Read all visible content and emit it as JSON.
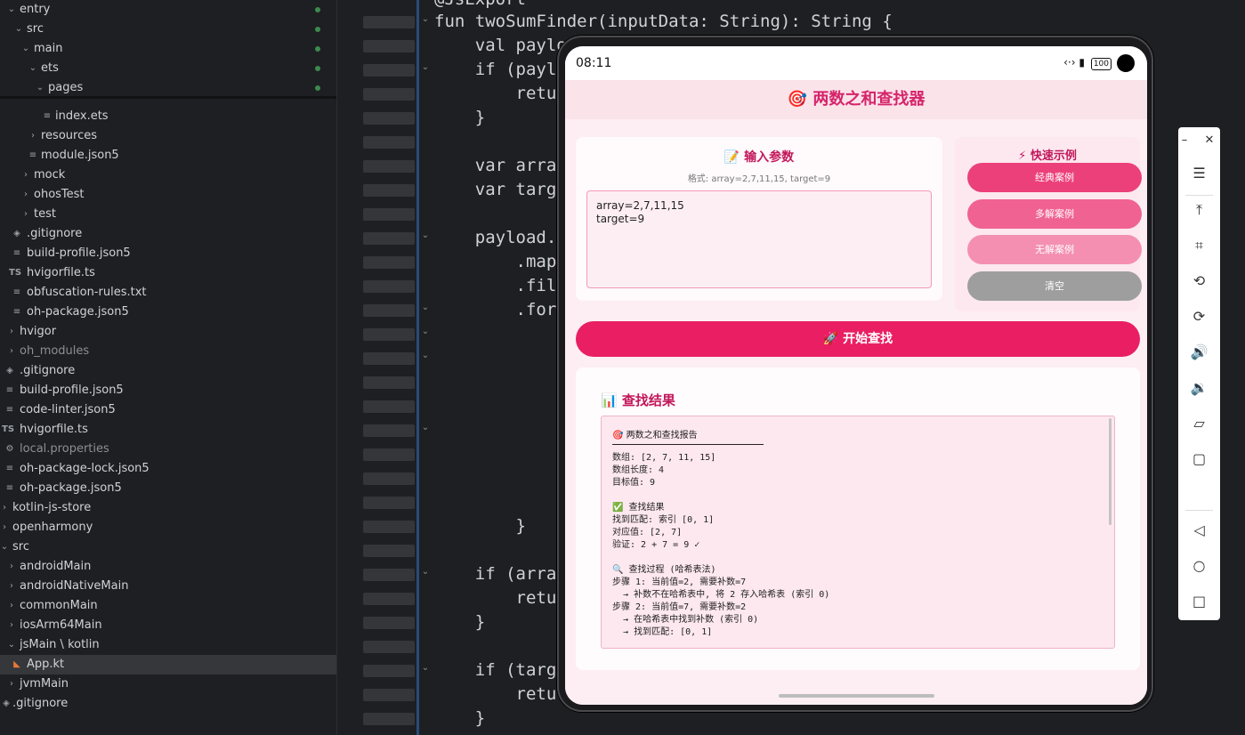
{
  "tree": {
    "items": [
      {
        "label": "entry"
      },
      {
        "label": "src"
      },
      {
        "label": "main"
      },
      {
        "label": "ets"
      },
      {
        "label": "pages"
      },
      {
        "label": "index.ets"
      },
      {
        "label": "resources"
      },
      {
        "label": "module.json5"
      },
      {
        "label": "mock"
      },
      {
        "label": "ohosTest"
      },
      {
        "label": "test"
      },
      {
        "label": ".gitignore"
      },
      {
        "label": "build-profile.json5"
      },
      {
        "label": "hvigorfile.ts"
      },
      {
        "label": "obfuscation-rules.txt"
      },
      {
        "label": "oh-package.json5"
      },
      {
        "label": "hvigor"
      },
      {
        "label": "oh_modules"
      },
      {
        "label": ".gitignore"
      },
      {
        "label": "build-profile.json5"
      },
      {
        "label": "code-linter.json5"
      },
      {
        "label": "hvigorfile.ts"
      },
      {
        "label": "local.properties"
      },
      {
        "label": "oh-package-lock.json5"
      },
      {
        "label": "oh-package.json5"
      },
      {
        "label": "kotlin-js-store"
      },
      {
        "label": "openharmony"
      },
      {
        "label": "src"
      },
      {
        "label": "androidMain"
      },
      {
        "label": "androidNativeMain"
      },
      {
        "label": "commonMain"
      },
      {
        "label": "iosArm64Main"
      },
      {
        "label": "jsMain \\ kotlin"
      },
      {
        "label": "App.kt"
      },
      {
        "label": "jvmMain"
      },
      {
        "label": ".gitignore"
      }
    ],
    "ts_badge": "TS"
  },
  "editor": {
    "lines": [
      "@JsExport",
      "fun twoSumFinder(inputData: String): String {",
      "    val payloa",
      "    if (paylo",
      "        retur",
      "    }",
      "",
      "    var array",
      "    var targe",
      "",
      "    payload.l",
      "        .map",
      "        .filt",
      "        .for",
      "            v",
      "",
      "",
      "",
      "",
      "",
      "",
      "        }",
      "",
      "    if (array",
      "        retur",
      "    }",
      "",
      "    if (targe",
      "        retur",
      "    }"
    ]
  },
  "phone": {
    "time": "08:11",
    "battery": "100",
    "app": {
      "title": "两数之和查找器",
      "title_icon": "🎯",
      "input": {
        "title": "输入参数",
        "title_icon": "📝",
        "hint": "格式: array=2,7,11,15, target=9",
        "value": "array=2,7,11,15\ntarget=9"
      },
      "quick": {
        "title": "快速示例",
        "title_icon": "⚡",
        "buttons": [
          {
            "label": "经典案例",
            "color": "#ec407a"
          },
          {
            "label": "多解案例",
            "color": "#f06292"
          },
          {
            "label": "无解案例",
            "color": "#f48fb1"
          },
          {
            "label": "清空",
            "color": "#9e9e9e"
          }
        ]
      },
      "start_button": "开始查找",
      "start_icon": "🚀",
      "result": {
        "title": "查找结果",
        "title_icon": "📊",
        "report_title": "两数之和查找报告",
        "report_icon": "🎯",
        "body": "数组: [2, 7, 11, 15]\n数组长度: 4\n目标值: 9\n\n✅ 查找结果\n找到匹配: 索引 [0, 1]\n对应值: [2, 7]\n验证: 2 + 7 = 9 ✓\n\n🔍 查找过程 (哈希表法)\n步骤 1: 当前值=2, 需要补数=7\n  → 补数不在哈希表中, 将 2 存入哈希表 (索引 0)\n步骤 2: 当前值=7, 需要补数=2\n  → 在哈希表中找到补数 (索引 0)\n  → 找到匹配: [0, 1]"
      }
    }
  },
  "colors": {
    "accent": "#e91e63",
    "title_pink": "#c2185b"
  }
}
